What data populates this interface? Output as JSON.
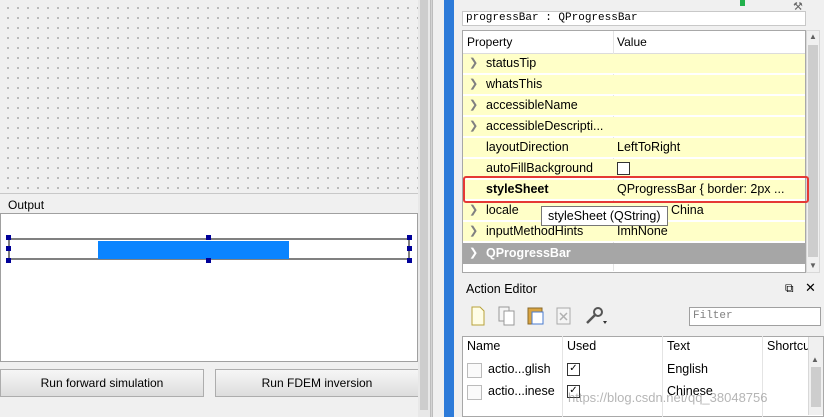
{
  "designer": {
    "output_label": "Output",
    "progress_fraction_start": 0.22,
    "progress_fraction_end": 0.7,
    "buttons": {
      "forward": "Run forward simulation",
      "inversion": "Run FDEM inversion"
    }
  },
  "property_editor": {
    "object_label": "progressBar : QProgressBar",
    "headers": {
      "property": "Property",
      "value": "Value"
    },
    "rows": [
      {
        "name": "statusTip",
        "value": ""
      },
      {
        "name": "whatsThis",
        "value": ""
      },
      {
        "name": "accessibleName",
        "value": ""
      },
      {
        "name": "accessibleDescripti...",
        "value": ""
      },
      {
        "name": "layoutDirection",
        "value": "LeftToRight"
      },
      {
        "name": "autoFillBackground",
        "value": ""
      },
      {
        "name": "styleSheet",
        "value": "QProgressBar {    border: 2px ..."
      },
      {
        "name": "locale",
        "value": "China"
      },
      {
        "name": "inputMethodHints",
        "value": "ImhNone"
      }
    ],
    "group": "QProgressBar",
    "tooltip": "styleSheet (QString)"
  },
  "action_editor": {
    "title": "Action Editor",
    "float_icon": "float-icon",
    "close_icon": "close-icon",
    "filter_placeholder": "Filter",
    "headers": {
      "name": "Name",
      "used": "Used",
      "text": "Text",
      "shortcut": "Shortcu"
    },
    "rows": [
      {
        "name": "actio...glish",
        "used": true,
        "text": "English"
      },
      {
        "name": "actio...inese",
        "used": true,
        "text": "Chinese"
      }
    ]
  },
  "watermark": "https://blog.csdn.net/qq_38048756",
  "colors": {
    "progress_chunk": "#0a84ff",
    "highlight": "#e53935",
    "property_row": "#ffffc8"
  }
}
